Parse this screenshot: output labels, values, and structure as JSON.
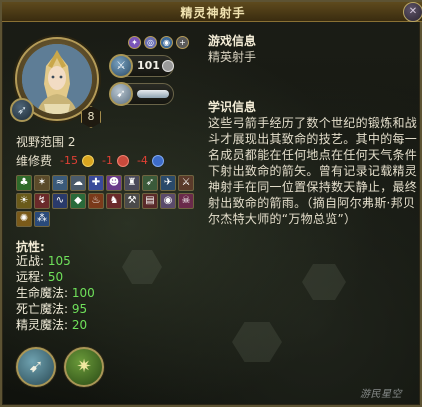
{
  "window": {
    "title": "精灵神射手",
    "close_icon": "close-icon"
  },
  "unit": {
    "level": "8",
    "status_icons": [
      {
        "name": "shield-status-icon",
        "glyph": "✦",
        "color": "#7a55b8"
      },
      {
        "name": "rings-status-icon",
        "glyph": "◎",
        "color": "#6a6fb4"
      },
      {
        "name": "disk-status-icon",
        "glyph": "◉",
        "color": "#3c6a9a"
      },
      {
        "name": "plus-status-icon",
        "glyph": "+",
        "color": "#5a5a5a"
      }
    ],
    "hp_value": "101",
    "hp_icon": "sword-icon",
    "move_icon": "boot-icon"
  },
  "stats": {
    "vision_label": "视野范围",
    "vision_value": "2",
    "upkeep_label": "维修费",
    "upkeep": [
      {
        "value": "-15",
        "icon": "gold-icon",
        "color": "#d9a520"
      },
      {
        "value": "-1",
        "icon": "mana-icon",
        "color": "#c84a3c"
      },
      {
        "value": "-4",
        "icon": "food-icon",
        "color": "#3d6cc9"
      }
    ]
  },
  "abilities": [
    {
      "name": "tree-ability-icon",
      "glyph": "♣",
      "bg": "#2f6a2a"
    },
    {
      "name": "star-ability-icon",
      "glyph": "✶",
      "bg": "#5a4a2a"
    },
    {
      "name": "boot-ability-icon",
      "glyph": "≈",
      "bg": "#3a5a7a"
    },
    {
      "name": "cloud-ability-icon",
      "glyph": "☁",
      "bg": "#4a5a6a"
    },
    {
      "name": "cross-ability-icon",
      "glyph": "✚",
      "bg": "#3a4a9a"
    },
    {
      "name": "mask-ability-icon",
      "glyph": "☻",
      "bg": "#6a3a8a"
    },
    {
      "name": "armor-ability-icon",
      "glyph": "♜",
      "bg": "#4a4a5a"
    },
    {
      "name": "bow-ability-icon",
      "glyph": "➶",
      "bg": "#3a5a3a"
    },
    {
      "name": "wing-ability-icon",
      "glyph": "✈",
      "bg": "#2a4a6a"
    },
    {
      "name": "swords-ability-icon",
      "glyph": "⚔",
      "bg": "#5a3a2a"
    },
    {
      "name": "sun-ability-icon",
      "glyph": "☀",
      "bg": "#6a5a1a"
    },
    {
      "name": "bolt-ability-icon",
      "glyph": "↯",
      "bg": "#6a2a2a"
    },
    {
      "name": "wave-ability-icon",
      "glyph": "∿",
      "bg": "#2a3a6a"
    },
    {
      "name": "gem-ability-icon",
      "glyph": "◆",
      "bg": "#2a6a3a"
    },
    {
      "name": "flame-ability-icon",
      "glyph": "♨",
      "bg": "#7a3a1a"
    },
    {
      "name": "figure-ability-icon",
      "glyph": "♞",
      "bg": "#6a2a2a"
    },
    {
      "name": "axe-ability-icon",
      "glyph": "⚒",
      "bg": "#4a4a4a"
    },
    {
      "name": "book-ability-icon",
      "glyph": "▤",
      "bg": "#5a2a2a"
    },
    {
      "name": "eye-ability-icon",
      "glyph": "◉",
      "bg": "#5a4a6a"
    },
    {
      "name": "skull-ability-icon",
      "glyph": "☠",
      "bg": "#6a2a4a"
    },
    {
      "name": "sun2-ability-icon",
      "glyph": "✺",
      "bg": "#7a5a1a"
    },
    {
      "name": "twin-ability-icon",
      "glyph": "⁂",
      "bg": "#2a4a7a"
    }
  ],
  "resistances": {
    "title": "抗性:",
    "rows": [
      {
        "label": "近战: ",
        "value": "105"
      },
      {
        "label": "远程: ",
        "value": "50"
      },
      {
        "label": "生命魔法: ",
        "value": "100"
      },
      {
        "label": "死亡魔法: ",
        "value": "95"
      },
      {
        "label": "精灵魔法: ",
        "value": "20"
      }
    ]
  },
  "actions": [
    {
      "name": "move-action-button",
      "icon": "boot-icon",
      "glyph": "➹",
      "bg": "#3f6e7a"
    },
    {
      "name": "attack-action-button",
      "icon": "bow-icon",
      "glyph": "✷",
      "bg": "#3f6a2a"
    }
  ],
  "info": {
    "game_info_title": "游戏信息",
    "game_info_value": "精英射手",
    "lore_title": "学识信息",
    "lore_text": "这些弓箭手经历了数个世纪的锻炼和战斗才展现出其致命的技艺。其中的每一名成员都能在任何地点在任何天气条件下射出致命的箭矢。曾有记录记载精灵神射手在同一位置保持数天静止，最终射出致命的箭雨。（摘自阿尔弗斯·邦贝尔杰特大师的“万物总览”）"
  },
  "watermark": "游民星空"
}
